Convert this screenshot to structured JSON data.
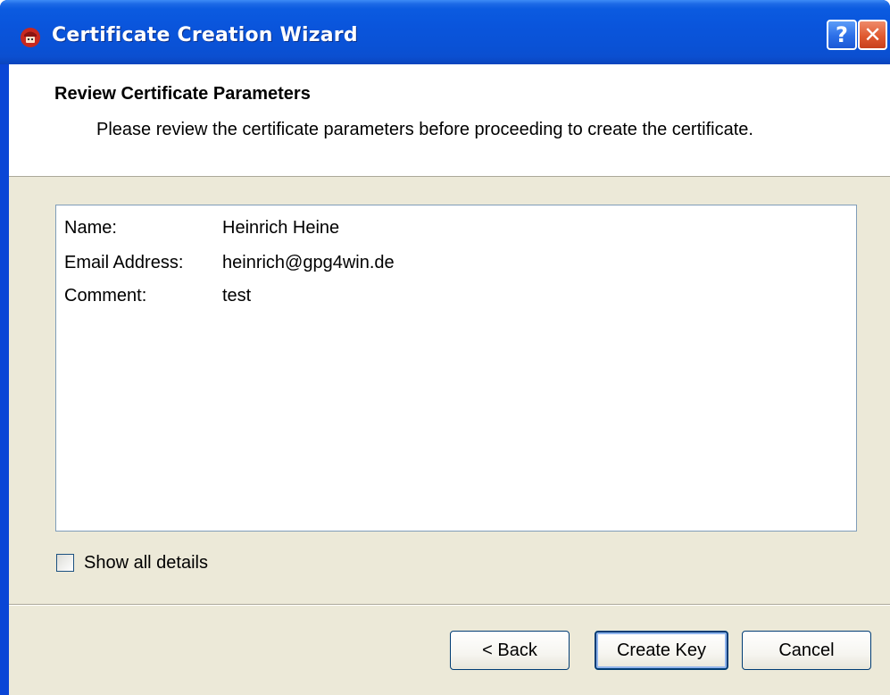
{
  "window": {
    "title": "Certificate Creation Wizard",
    "help_label": "?",
    "close_label": "✕"
  },
  "header": {
    "title": "Review Certificate Parameters",
    "subtitle": "Please review the certificate parameters before proceeding to create the certificate."
  },
  "parameters": [
    {
      "label": "Name:",
      "value": "Heinrich Heine"
    },
    {
      "label": "Email Address:",
      "value": "heinrich@gpg4win.de"
    },
    {
      "label": "Comment:",
      "value": "test"
    }
  ],
  "show_details": {
    "label": "Show all details",
    "checked": false
  },
  "buttons": {
    "back": "< Back",
    "create": "Create Key",
    "cancel": "Cancel"
  },
  "colors": {
    "titlebar": "#0a55dc",
    "client_bg": "#ece9d8",
    "close_button": "#e05a30"
  }
}
